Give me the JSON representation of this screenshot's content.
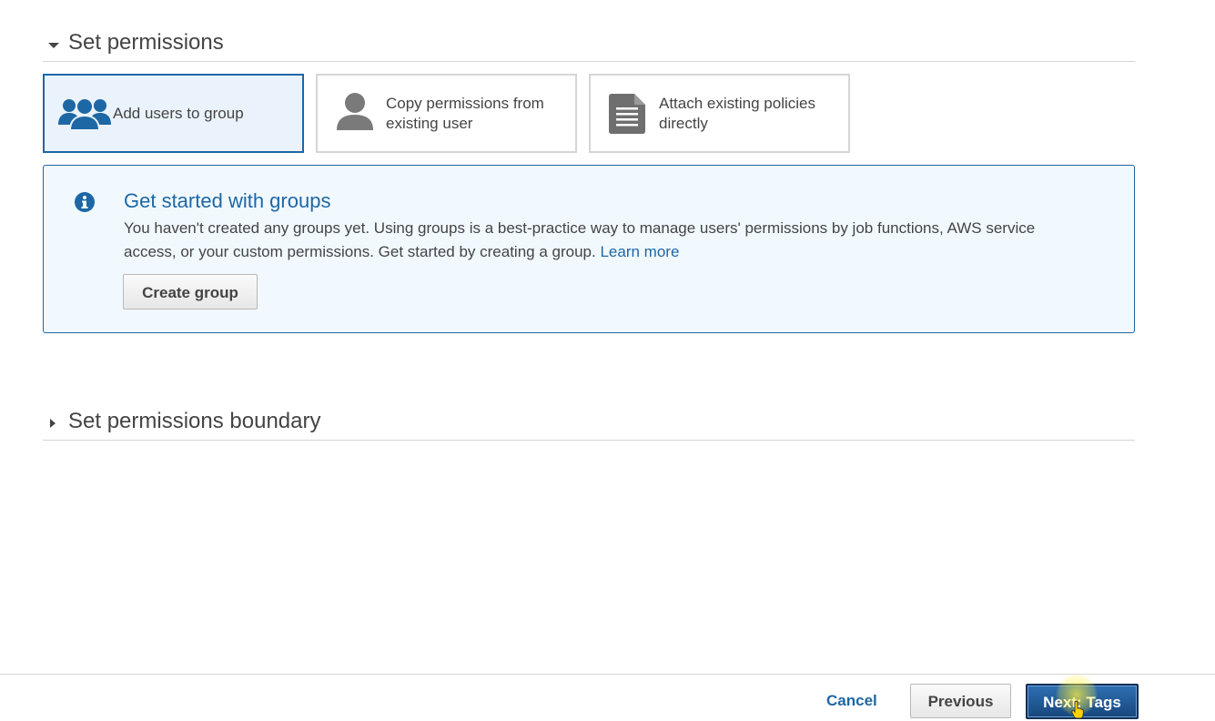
{
  "permissions_section": {
    "title": "Set permissions",
    "expanded": true,
    "options": [
      {
        "label": "Add users to group",
        "icon": "users-group-icon",
        "selected": true
      },
      {
        "label": "Copy permissions from existing user",
        "icon": "user-icon",
        "selected": false
      },
      {
        "label": "Attach existing policies directly",
        "icon": "document-icon",
        "selected": false
      }
    ]
  },
  "info_box": {
    "icon": "info-icon",
    "heading": "Get started with groups",
    "body": "You haven't created any groups yet. Using groups is a best-practice way to manage users' permissions by job functions, AWS service access, or your custom permissions. Get started by creating a group.",
    "learn_more_label": "Learn more",
    "create_group_label": "Create group"
  },
  "boundary_section": {
    "title": "Set permissions boundary",
    "expanded": false
  },
  "footer": {
    "cancel_label": "Cancel",
    "previous_label": "Previous",
    "next_label": "Next: Tags"
  },
  "colors": {
    "accent": "#1e67a5",
    "selected_tile_bg": "#eaf3fb",
    "info_bg": "#f1f9ff",
    "primary_button": "#1f5a99"
  }
}
